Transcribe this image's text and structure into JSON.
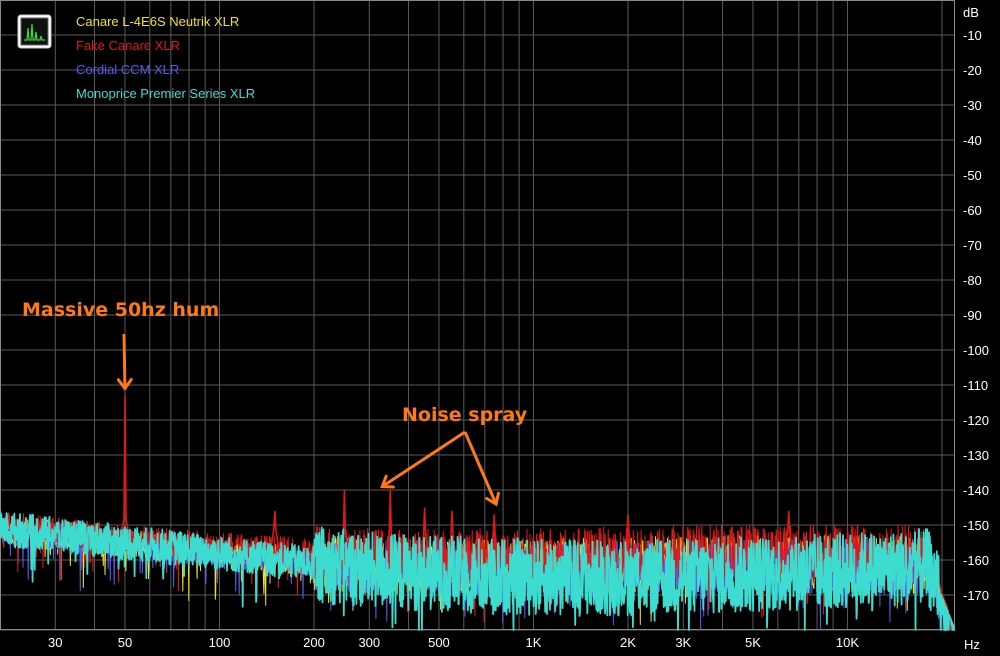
{
  "chart_data": {
    "type": "line",
    "x_scale": "log",
    "xlim": [
      20,
      22000
    ],
    "ylim": [
      -180,
      0
    ],
    "ylabel": "dB",
    "xlabel": "Hz",
    "grid": true,
    "legend_position": "top-left",
    "x_ticks": [
      {
        "value": 30,
        "label": "30"
      },
      {
        "value": 50,
        "label": "50"
      },
      {
        "value": 100,
        "label": "100"
      },
      {
        "value": 200,
        "label": "200"
      },
      {
        "value": 300,
        "label": "300"
      },
      {
        "value": 500,
        "label": "500"
      },
      {
        "value": 1000,
        "label": "1K"
      },
      {
        "value": 2000,
        "label": "2K"
      },
      {
        "value": 3000,
        "label": "3K"
      },
      {
        "value": 5000,
        "label": "5K"
      },
      {
        "value": 10000,
        "label": "10K"
      }
    ],
    "y_ticks": [
      {
        "value": -10,
        "label": "-10"
      },
      {
        "value": -20,
        "label": "-20"
      },
      {
        "value": -30,
        "label": "-30"
      },
      {
        "value": -40,
        "label": "-40"
      },
      {
        "value": -50,
        "label": "-50"
      },
      {
        "value": -60,
        "label": "-60"
      },
      {
        "value": -70,
        "label": "-70"
      },
      {
        "value": -80,
        "label": "-80"
      },
      {
        "value": -90,
        "label": "-90"
      },
      {
        "value": -100,
        "label": "-100"
      },
      {
        "value": -110,
        "label": "-110"
      },
      {
        "value": -120,
        "label": "-120"
      },
      {
        "value": -130,
        "label": "-130"
      },
      {
        "value": -140,
        "label": "-140"
      },
      {
        "value": -150,
        "label": "-150"
      },
      {
        "value": -160,
        "label": "-160"
      },
      {
        "value": -170,
        "label": "-170"
      }
    ],
    "series": [
      {
        "name": "Canare L-4E6S Neutrik XLR",
        "color": "#f2e21a",
        "noise_floor": [
          [
            20,
            -151
          ],
          [
            50,
            -155
          ],
          [
            100,
            -158
          ],
          [
            300,
            -162
          ],
          [
            1000,
            -162
          ],
          [
            3000,
            -161
          ],
          [
            10000,
            -161
          ],
          [
            18000,
            -161
          ],
          [
            19500,
            -167
          ],
          [
            22000,
            -180
          ]
        ],
        "peaks": []
      },
      {
        "name": "Fake Canare XLR",
        "color": "#e01818",
        "noise_floor": [
          [
            20,
            -150
          ],
          [
            50,
            -154
          ],
          [
            100,
            -156
          ],
          [
            300,
            -159
          ],
          [
            1000,
            -159
          ],
          [
            3000,
            -158
          ],
          [
            10000,
            -158
          ],
          [
            18000,
            -158
          ],
          [
            19500,
            -166
          ],
          [
            22000,
            -180
          ]
        ],
        "peaks": [
          [
            50,
            -113
          ],
          [
            150,
            -146
          ],
          [
            250,
            -140
          ],
          [
            350,
            -140
          ],
          [
            450,
            -145
          ],
          [
            550,
            -146
          ],
          [
            750,
            -147
          ],
          [
            2000,
            -147
          ],
          [
            6500,
            -146
          ]
        ]
      },
      {
        "name": "Cordial CCM XLR",
        "color": "#5a5af0",
        "noise_floor": [
          [
            20,
            -152
          ],
          [
            50,
            -155
          ],
          [
            100,
            -158
          ],
          [
            300,
            -162
          ],
          [
            1000,
            -163
          ],
          [
            3000,
            -162
          ],
          [
            10000,
            -162
          ],
          [
            18000,
            -162
          ],
          [
            19500,
            -168
          ],
          [
            22000,
            -180
          ]
        ],
        "peaks": []
      },
      {
        "name": "Monoprice Premier Series XLR",
        "color": "#3ddcd0",
        "noise_floor": [
          [
            20,
            -151
          ],
          [
            50,
            -155
          ],
          [
            100,
            -158
          ],
          [
            300,
            -163
          ],
          [
            1000,
            -165
          ],
          [
            3000,
            -165
          ],
          [
            10000,
            -163
          ],
          [
            18000,
            -162
          ],
          [
            19500,
            -168
          ],
          [
            22000,
            -180
          ]
        ],
        "peaks": []
      }
    ],
    "annotations": [
      {
        "text": "Massive 50hz hum",
        "arrow_to": [
          50,
          -111
        ]
      },
      {
        "text": "Noise spray",
        "arrow_to": [
          [
            330,
            -139
          ],
          [
            760,
            -144
          ]
        ]
      }
    ]
  }
}
